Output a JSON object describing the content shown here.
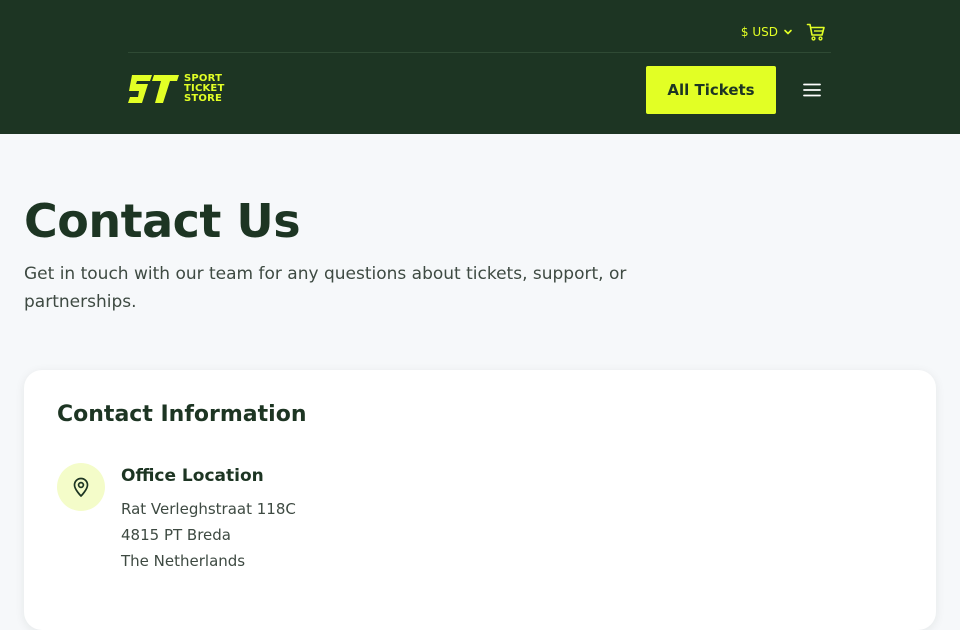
{
  "header": {
    "currency_label": "$ USD",
    "logo_lines": [
      "SPORT",
      "TICKET",
      "STORE"
    ],
    "all_tickets_label": "All Tickets",
    "icons": {
      "cart": "cart-icon",
      "menu": "menu-icon",
      "chevron": "chevron-down-icon"
    }
  },
  "hero": {
    "title": "Contact Us",
    "subtitle": "Get in touch with our team for any questions about tickets, support, or partnerships."
  },
  "contact_card": {
    "title": "Contact Information",
    "office": {
      "heading": "Office Location",
      "address_lines": [
        "Rat Verleghstraat 118C",
        "4815 PT Breda",
        "The Netherlands"
      ],
      "icon": "map-pin-icon"
    }
  },
  "colors": {
    "header_bg": "#1d3523",
    "accent": "#e2ff25",
    "page_bg": "#f6f8fa",
    "text_dark": "#1d3523"
  }
}
